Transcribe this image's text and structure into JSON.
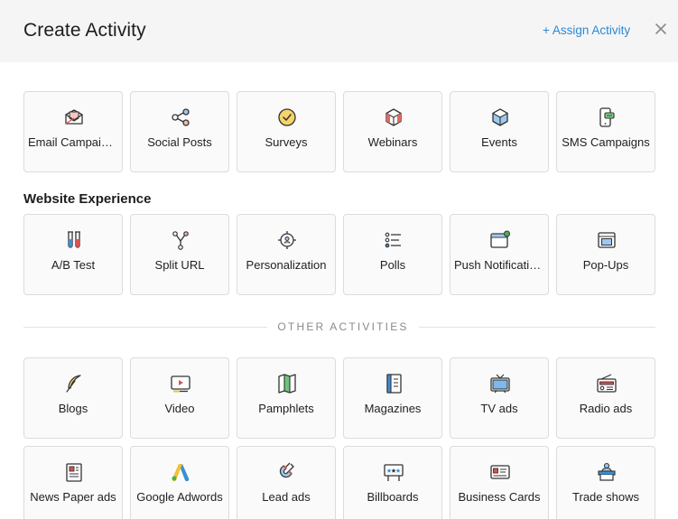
{
  "header": {
    "title": "Create Activity",
    "assign_label": "+ Assign Activity",
    "close_icon": "close-icon"
  },
  "colors": {
    "accent": "#2b88d8",
    "header_bg": "#f5f5f5",
    "tile_border": "#dcdcdc",
    "icon_red": "#d9534f",
    "icon_blue": "#3b8fd4",
    "icon_green": "#4caf50",
    "icon_yellow": "#f1c232"
  },
  "main": {
    "items": [
      {
        "label": "Email Campaigns",
        "icon": "envelope-icon"
      },
      {
        "label": "Social Posts",
        "icon": "share-icon"
      },
      {
        "label": "Surveys",
        "icon": "check-circle-icon"
      },
      {
        "label": "Webinars",
        "icon": "webinar-cube-icon"
      },
      {
        "label": "Events",
        "icon": "event-cube-icon"
      },
      {
        "label": "SMS Campaigns",
        "icon": "phone-message-icon"
      }
    ]
  },
  "website": {
    "title": "Website Experience",
    "items": [
      {
        "label": "A/B Test",
        "icon": "test-tubes-icon"
      },
      {
        "label": "Split URL",
        "icon": "split-icon"
      },
      {
        "label": "Personalization",
        "icon": "target-user-icon"
      },
      {
        "label": "Polls",
        "icon": "list-icon"
      },
      {
        "label": "Push Notifications",
        "icon": "browser-bell-icon"
      },
      {
        "label": "Pop-Ups",
        "icon": "popup-window-icon"
      }
    ]
  },
  "other": {
    "title": "OTHER ACTIVITIES",
    "items": [
      {
        "label": "Blogs",
        "icon": "feather-icon"
      },
      {
        "label": "Video",
        "icon": "video-icon"
      },
      {
        "label": "Pamphlets",
        "icon": "pamphlet-icon"
      },
      {
        "label": "Magazines",
        "icon": "magazine-icon"
      },
      {
        "label": "TV ads",
        "icon": "tv-icon"
      },
      {
        "label": "Radio ads",
        "icon": "radio-icon"
      },
      {
        "label": "News Paper ads",
        "icon": "newspaper-icon"
      },
      {
        "label": "Google Adwords",
        "icon": "adwords-icon"
      },
      {
        "label": "Lead ads",
        "icon": "magnet-icon"
      },
      {
        "label": "Billboards",
        "icon": "billboard-icon"
      },
      {
        "label": "Business Cards",
        "icon": "business-card-icon"
      },
      {
        "label": "Trade shows",
        "icon": "trade-show-icon"
      }
    ]
  }
}
